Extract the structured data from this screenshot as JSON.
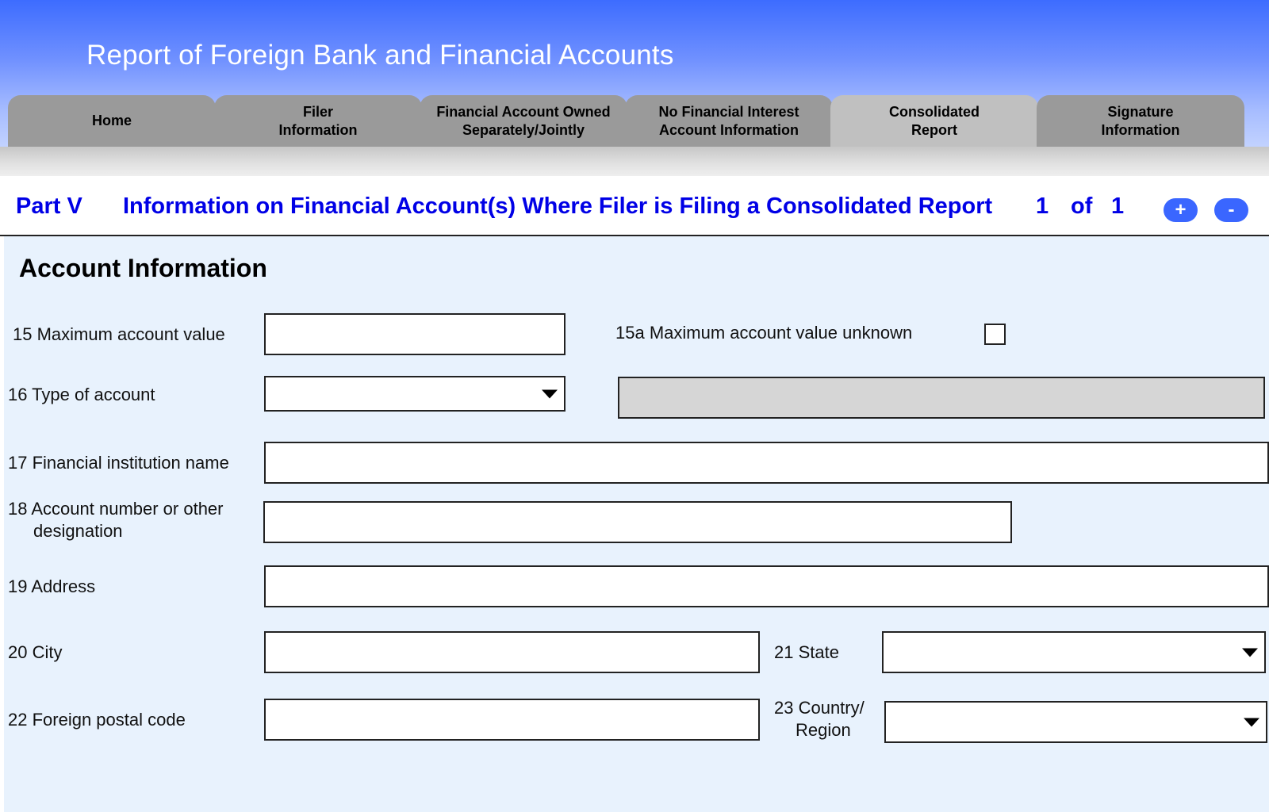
{
  "header": {
    "title": "Report of Foreign Bank and Financial Accounts"
  },
  "tabs": [
    {
      "label": "Home",
      "active": false
    },
    {
      "label": "Filer\nInformation",
      "active": false
    },
    {
      "label": "Financial Account Owned\nSeparately/Jointly",
      "active": false
    },
    {
      "label": "No Financial Interest\nAccount Information",
      "active": false
    },
    {
      "label": "Consolidated\nReport",
      "active": true
    },
    {
      "label": "Signature\nInformation",
      "active": false
    }
  ],
  "part": {
    "label": "Part V",
    "title": "Information on Financial Account(s) Where Filer is Filing a Consolidated Report",
    "current_page": "1",
    "of_label": "of",
    "total_pages": "1",
    "add_button": "+",
    "remove_button": "-"
  },
  "form": {
    "section_title": "Account Information",
    "fields": {
      "max_value": {
        "label": "15 Maximum account value",
        "value": ""
      },
      "max_value_unknown": {
        "label": "15a Maximum account value unknown",
        "checked": false
      },
      "account_type": {
        "label": "16 Type of account",
        "value": ""
      },
      "account_type_other": {
        "value": ""
      },
      "institution_name": {
        "label": "17 Financial institution name",
        "value": ""
      },
      "account_number": {
        "label_line1": "18 Account number or other",
        "label_line2": "designation",
        "value": ""
      },
      "address": {
        "label": "19  Address",
        "value": ""
      },
      "city": {
        "label": "20  City",
        "value": ""
      },
      "state": {
        "label": "21 State",
        "value": ""
      },
      "postal_code": {
        "label": "22 Foreign postal code",
        "value": ""
      },
      "country": {
        "label_line1": "23 Country/",
        "label_line2": "Region",
        "value": ""
      }
    }
  },
  "colors": {
    "header_top": "#3d6cff",
    "part_text": "#0000e6",
    "pill_button": "#3a66ff",
    "panel_bg": "#e8f2fd",
    "tab_inactive": "#9a9a9a",
    "tab_active": "#c0c0c0"
  }
}
